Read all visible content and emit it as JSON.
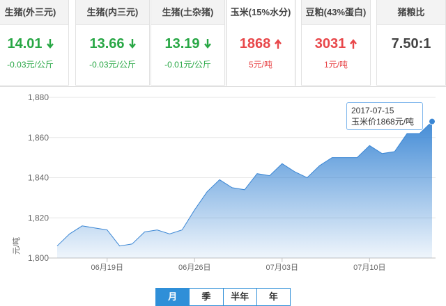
{
  "cards": [
    {
      "name": "生猪(外三元)",
      "price": "14.01",
      "change": "-0.03元/公斤",
      "trend": "down"
    },
    {
      "name": "生猪(内三元)",
      "price": "13.66",
      "change": "-0.03元/公斤",
      "trend": "down"
    },
    {
      "name": "生猪(土杂猪)",
      "price": "13.19",
      "change": "-0.01元/公斤",
      "trend": "down"
    },
    {
      "name": "玉米(15%水分)",
      "price": "1868",
      "change": "5元/吨",
      "trend": "up"
    },
    {
      "name": "豆粕(43%蛋白)",
      "price": "3031",
      "change": "1元/吨",
      "trend": "up"
    },
    {
      "name": "猪粮比",
      "price": "7.50:1",
      "change": "",
      "trend": "none"
    }
  ],
  "colors": {
    "down": "#28a745",
    "up": "#e8474a",
    "series": "#3a86d4",
    "accent": "#2f8fd8"
  },
  "tooltip": {
    "date": "2017-07-15",
    "text": "玉米价1868元/吨"
  },
  "range_buttons": [
    "月",
    "季",
    "半年",
    "年"
  ],
  "range_selected": "月",
  "chart_data": {
    "type": "area",
    "ylabel": "元/吨",
    "ylim": [
      1800,
      1880
    ],
    "y_ticks": [
      "1,800",
      "1,820",
      "1,840",
      "1,860",
      "1,880"
    ],
    "x_ticks": [
      "06月19日",
      "06月26日",
      "07月03日",
      "07月10日"
    ],
    "x": [
      "2017-06-15",
      "2017-06-16",
      "2017-06-17",
      "2017-06-18",
      "2017-06-19",
      "2017-06-20",
      "2017-06-21",
      "2017-06-22",
      "2017-06-23",
      "2017-06-24",
      "2017-06-25",
      "2017-06-26",
      "2017-06-27",
      "2017-06-28",
      "2017-06-29",
      "2017-06-30",
      "2017-07-01",
      "2017-07-02",
      "2017-07-03",
      "2017-07-04",
      "2017-07-05",
      "2017-07-06",
      "2017-07-07",
      "2017-07-08",
      "2017-07-09",
      "2017-07-10",
      "2017-07-11",
      "2017-07-12",
      "2017-07-13",
      "2017-07-14",
      "2017-07-15"
    ],
    "series": [
      {
        "values": [
          1806,
          1812,
          1816,
          1815,
          1814,
          1806,
          1807,
          1813,
          1814,
          1812,
          1814,
          1824,
          1833,
          1839,
          1835,
          1834,
          1842,
          1841,
          1847,
          1843,
          1840,
          1846,
          1850,
          1850,
          1850,
          1856,
          1852,
          1853,
          1862,
          1862,
          1868
        ]
      }
    ],
    "grid": true,
    "highlight_index": 30
  }
}
